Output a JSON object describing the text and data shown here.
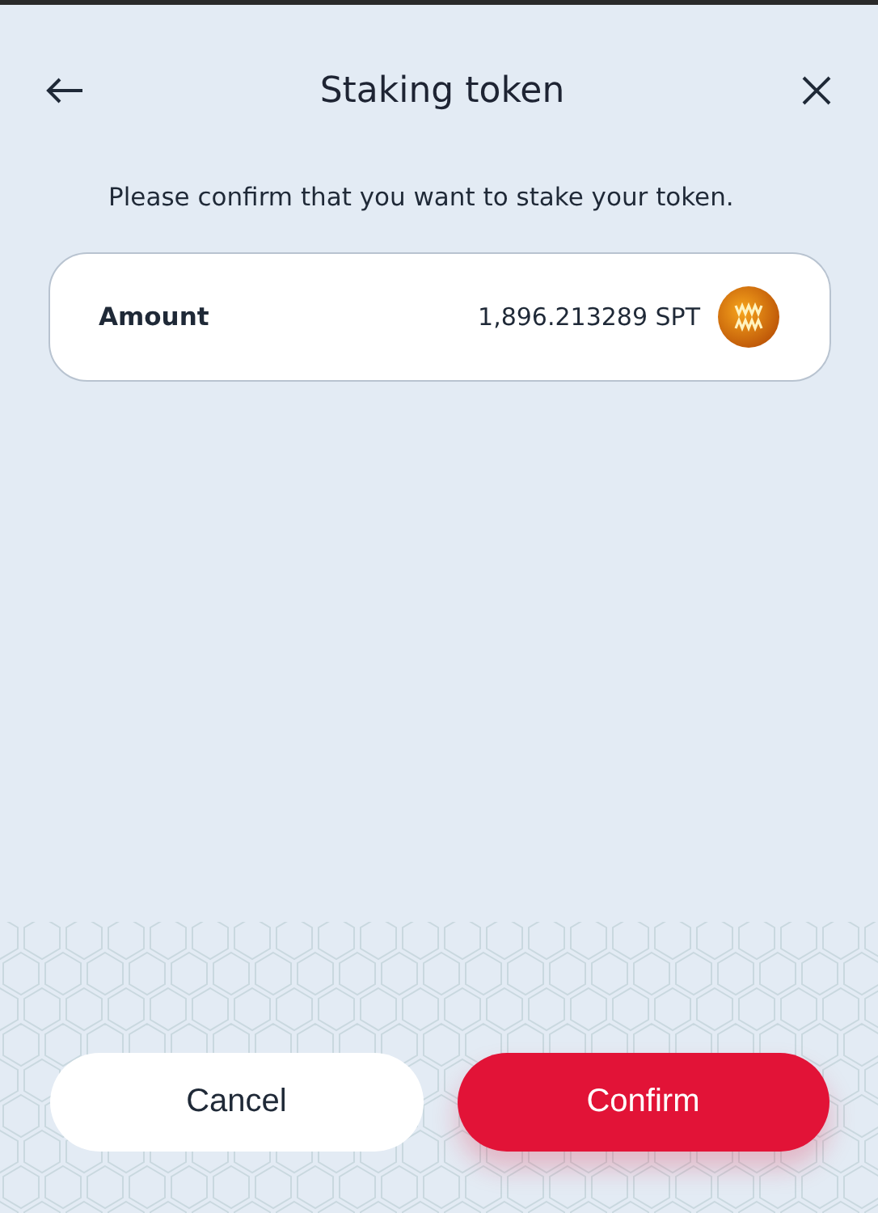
{
  "header": {
    "title": "Staking token"
  },
  "message": "Please confirm that you want to stake your token.",
  "summary": {
    "label": "Amount",
    "value": "1,896.213289 SPT"
  },
  "buttons": [
    {
      "label": "Cancel",
      "kind": "secondary"
    },
    {
      "label": "Confirm",
      "kind": "primary"
    }
  ]
}
